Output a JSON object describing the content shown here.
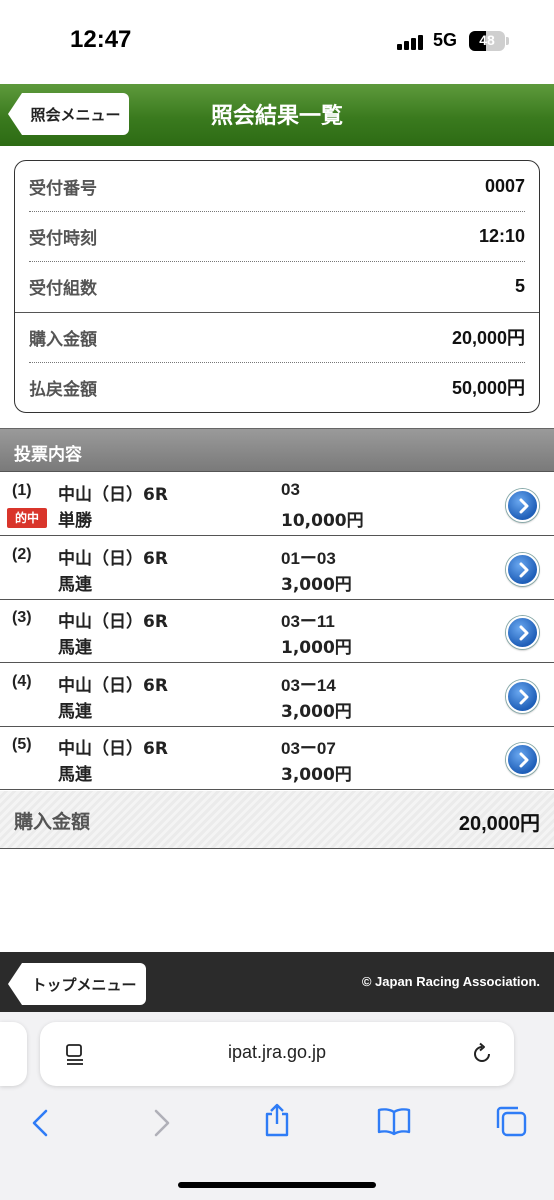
{
  "status_bar": {
    "time": "12:47",
    "network": "5G",
    "battery": "48",
    "battery_level": 0.48
  },
  "header": {
    "back_label": "照会メニュー",
    "title": "照会結果一覧"
  },
  "summary": [
    {
      "label": "受付番号",
      "value": "0007"
    },
    {
      "label": "受付時刻",
      "value": "12:10"
    },
    {
      "label": "受付組数",
      "value": "5"
    },
    {
      "label": "購入金額",
      "value": "20,000円"
    },
    {
      "label": "払戻金額",
      "value": "50,000円"
    }
  ],
  "votes_header": "投票内容",
  "hit_badge": "的中",
  "votes": [
    {
      "num": "(1)",
      "race": "中山（日）6R",
      "type": "単勝",
      "combo": "03",
      "amount": "10,000円",
      "hit": true
    },
    {
      "num": "(2)",
      "race": "中山（日）6R",
      "type": "馬連",
      "combo": "01ー03",
      "amount": "3,000円",
      "hit": false
    },
    {
      "num": "(3)",
      "race": "中山（日）6R",
      "type": "馬連",
      "combo": "03ー11",
      "amount": "1,000円",
      "hit": false
    },
    {
      "num": "(4)",
      "race": "中山（日）6R",
      "type": "馬連",
      "combo": "03ー14",
      "amount": "3,000円",
      "hit": false
    },
    {
      "num": "(5)",
      "race": "中山（日）6R",
      "type": "馬連",
      "combo": "03ー07",
      "amount": "3,000円",
      "hit": false
    }
  ],
  "total": {
    "label": "購入金額",
    "value": "20,000円"
  },
  "footer": {
    "top_label": "トップメニュー",
    "copyright": "© Japan Racing Association."
  },
  "browser": {
    "url": "ipat.jra.go.jp"
  }
}
